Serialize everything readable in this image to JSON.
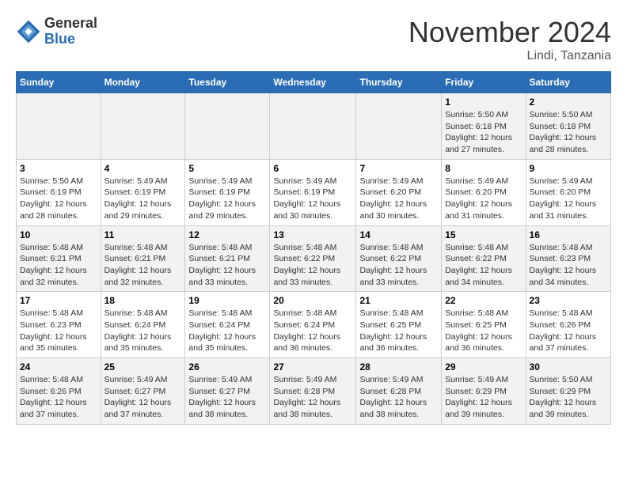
{
  "header": {
    "logo_line1": "General",
    "logo_line2": "Blue",
    "month_title": "November 2024",
    "location": "Lindi, Tanzania"
  },
  "weekdays": [
    "Sunday",
    "Monday",
    "Tuesday",
    "Wednesday",
    "Thursday",
    "Friday",
    "Saturday"
  ],
  "weeks": [
    [
      {
        "day": "",
        "info": ""
      },
      {
        "day": "",
        "info": ""
      },
      {
        "day": "",
        "info": ""
      },
      {
        "day": "",
        "info": ""
      },
      {
        "day": "",
        "info": ""
      },
      {
        "day": "1",
        "info": "Sunrise: 5:50 AM\nSunset: 6:18 PM\nDaylight: 12 hours and 27 minutes."
      },
      {
        "day": "2",
        "info": "Sunrise: 5:50 AM\nSunset: 6:18 PM\nDaylight: 12 hours and 28 minutes."
      }
    ],
    [
      {
        "day": "3",
        "info": "Sunrise: 5:50 AM\nSunset: 6:19 PM\nDaylight: 12 hours and 28 minutes."
      },
      {
        "day": "4",
        "info": "Sunrise: 5:49 AM\nSunset: 6:19 PM\nDaylight: 12 hours and 29 minutes."
      },
      {
        "day": "5",
        "info": "Sunrise: 5:49 AM\nSunset: 6:19 PM\nDaylight: 12 hours and 29 minutes."
      },
      {
        "day": "6",
        "info": "Sunrise: 5:49 AM\nSunset: 6:19 PM\nDaylight: 12 hours and 30 minutes."
      },
      {
        "day": "7",
        "info": "Sunrise: 5:49 AM\nSunset: 6:20 PM\nDaylight: 12 hours and 30 minutes."
      },
      {
        "day": "8",
        "info": "Sunrise: 5:49 AM\nSunset: 6:20 PM\nDaylight: 12 hours and 31 minutes."
      },
      {
        "day": "9",
        "info": "Sunrise: 5:49 AM\nSunset: 6:20 PM\nDaylight: 12 hours and 31 minutes."
      }
    ],
    [
      {
        "day": "10",
        "info": "Sunrise: 5:48 AM\nSunset: 6:21 PM\nDaylight: 12 hours and 32 minutes."
      },
      {
        "day": "11",
        "info": "Sunrise: 5:48 AM\nSunset: 6:21 PM\nDaylight: 12 hours and 32 minutes."
      },
      {
        "day": "12",
        "info": "Sunrise: 5:48 AM\nSunset: 6:21 PM\nDaylight: 12 hours and 33 minutes."
      },
      {
        "day": "13",
        "info": "Sunrise: 5:48 AM\nSunset: 6:22 PM\nDaylight: 12 hours and 33 minutes."
      },
      {
        "day": "14",
        "info": "Sunrise: 5:48 AM\nSunset: 6:22 PM\nDaylight: 12 hours and 33 minutes."
      },
      {
        "day": "15",
        "info": "Sunrise: 5:48 AM\nSunset: 6:22 PM\nDaylight: 12 hours and 34 minutes."
      },
      {
        "day": "16",
        "info": "Sunrise: 5:48 AM\nSunset: 6:23 PM\nDaylight: 12 hours and 34 minutes."
      }
    ],
    [
      {
        "day": "17",
        "info": "Sunrise: 5:48 AM\nSunset: 6:23 PM\nDaylight: 12 hours and 35 minutes."
      },
      {
        "day": "18",
        "info": "Sunrise: 5:48 AM\nSunset: 6:24 PM\nDaylight: 12 hours and 35 minutes."
      },
      {
        "day": "19",
        "info": "Sunrise: 5:48 AM\nSunset: 6:24 PM\nDaylight: 12 hours and 35 minutes."
      },
      {
        "day": "20",
        "info": "Sunrise: 5:48 AM\nSunset: 6:24 PM\nDaylight: 12 hours and 36 minutes."
      },
      {
        "day": "21",
        "info": "Sunrise: 5:48 AM\nSunset: 6:25 PM\nDaylight: 12 hours and 36 minutes."
      },
      {
        "day": "22",
        "info": "Sunrise: 5:48 AM\nSunset: 6:25 PM\nDaylight: 12 hours and 36 minutes."
      },
      {
        "day": "23",
        "info": "Sunrise: 5:48 AM\nSunset: 6:26 PM\nDaylight: 12 hours and 37 minutes."
      }
    ],
    [
      {
        "day": "24",
        "info": "Sunrise: 5:48 AM\nSunset: 6:26 PM\nDaylight: 12 hours and 37 minutes."
      },
      {
        "day": "25",
        "info": "Sunrise: 5:49 AM\nSunset: 6:27 PM\nDaylight: 12 hours and 37 minutes."
      },
      {
        "day": "26",
        "info": "Sunrise: 5:49 AM\nSunset: 6:27 PM\nDaylight: 12 hours and 38 minutes."
      },
      {
        "day": "27",
        "info": "Sunrise: 5:49 AM\nSunset: 6:28 PM\nDaylight: 12 hours and 38 minutes."
      },
      {
        "day": "28",
        "info": "Sunrise: 5:49 AM\nSunset: 6:28 PM\nDaylight: 12 hours and 38 minutes."
      },
      {
        "day": "29",
        "info": "Sunrise: 5:49 AM\nSunset: 6:29 PM\nDaylight: 12 hours and 39 minutes."
      },
      {
        "day": "30",
        "info": "Sunrise: 5:50 AM\nSunset: 6:29 PM\nDaylight: 12 hours and 39 minutes."
      }
    ]
  ]
}
